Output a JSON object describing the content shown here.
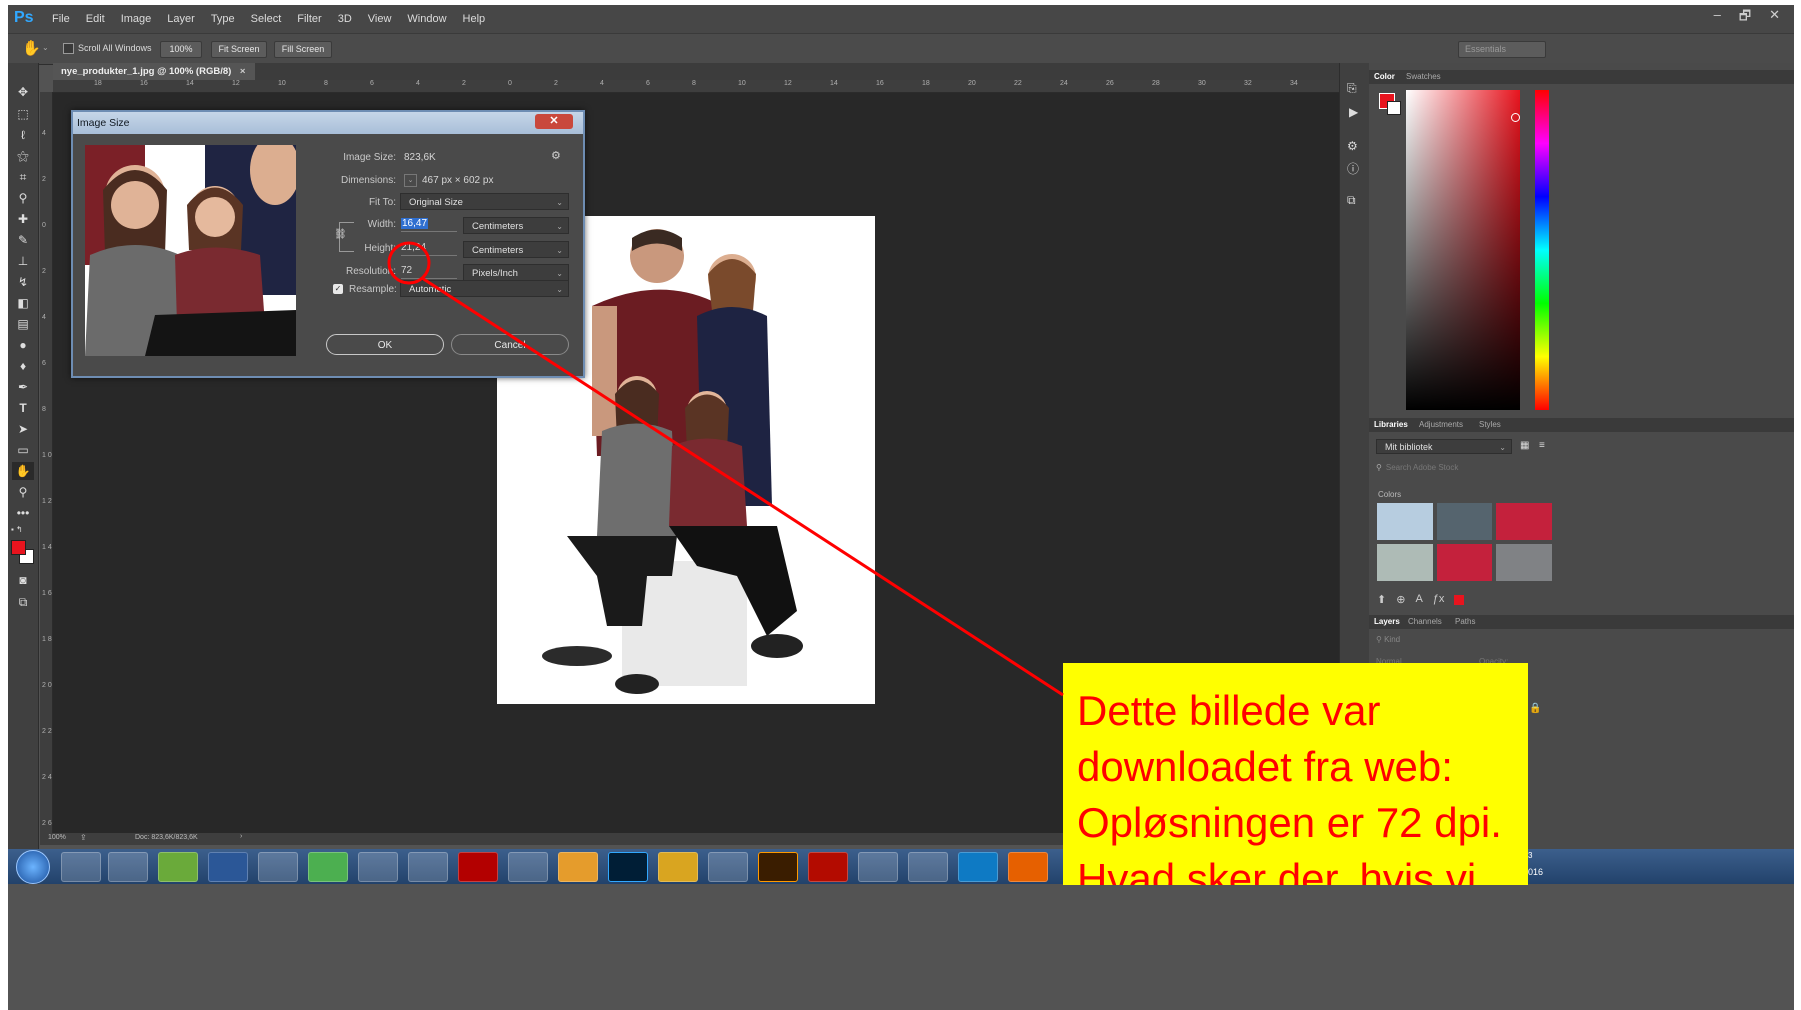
{
  "app": {
    "logo": "Ps",
    "menu": [
      "File",
      "Edit",
      "Image",
      "Layer",
      "Type",
      "Select",
      "Filter",
      "3D",
      "View",
      "Window",
      "Help"
    ],
    "window_controls": [
      "–",
      "🗗",
      "✕"
    ]
  },
  "options_bar": {
    "scroll_all_windows": "Scroll All Windows",
    "zoom_100": "100%",
    "fit_screen": "Fit Screen",
    "fill_screen": "Fill Screen",
    "workspace": "Essentials"
  },
  "document_tab": {
    "title": "nye_produkter_1.jpg @ 100% (RGB/8)",
    "close": "×"
  },
  "ruler": {
    "h_ticks": [
      "18",
      "16",
      "14",
      "12",
      "10",
      "8",
      "6",
      "4",
      "2",
      "0",
      "2",
      "4",
      "6",
      "8",
      "10",
      "12",
      "14",
      "16",
      "18",
      "20",
      "22",
      "24",
      "26",
      "28",
      "30",
      "32",
      "34"
    ],
    "v_ticks": [
      "4",
      "2",
      "0",
      "2",
      "4",
      "6",
      "8",
      "1 0",
      "1 2",
      "1 4",
      "1 6",
      "1 8",
      "2 0",
      "2 2",
      "2 4",
      "2 6"
    ]
  },
  "dialog": {
    "title": "Image Size",
    "close_label": "✕",
    "image_size_label": "Image Size:",
    "image_size_value": "823,6K",
    "dimensions_label": "Dimensions:",
    "dimensions_value": "467 px  ×  602 px",
    "fit_to_label": "Fit To:",
    "fit_to_value": "Original Size",
    "width_label": "Width:",
    "width_value": "16,47",
    "width_unit": "Centimeters",
    "height_label": "Height:",
    "height_value": "21,24",
    "height_unit": "Centimeters",
    "resolution_label": "Resolution:",
    "resolution_value": "72",
    "resolution_unit": "Pixels/Inch",
    "resample_label": "Resample:",
    "resample_value": "Automatic",
    "resample_checked": true,
    "ok": "OK",
    "cancel": "Cancel"
  },
  "right_panel": {
    "color_tabs": [
      "Color",
      "Swatches"
    ],
    "libraries_tabs": [
      "Libraries",
      "Adjustments",
      "Styles"
    ],
    "library_name": "Mit bibliotek",
    "search_placeholder": "Search Adobe Stock",
    "colors_label": "Colors",
    "swatches": [
      "#b7cde0",
      "#55646e",
      "#c4213c",
      "#aebbb6",
      "#c4213c",
      "#808285"
    ],
    "layers_tabs": [
      "Layers",
      "Channels",
      "Paths"
    ],
    "layers_kind": "Kind",
    "blend_mode": "Normal",
    "opacity_label": "Opacity:"
  },
  "status_bar": {
    "zoom": "100%",
    "doc": "Doc: 823,6K/823,6K"
  },
  "taskbar": {
    "clock_partial": "016",
    "clock_partial_top": "3"
  },
  "annotation": {
    "text": "Dette billede var\ndownloadet fra web:\nOpløsningen er 72 dpi.\nHvad sker der, hvis vi",
    "background": "#ffff00",
    "color": "#ff0000"
  },
  "colors": {
    "foreground": "#e8141e",
    "background": "#ffffff",
    "accent_blue": "#31a8ff"
  }
}
